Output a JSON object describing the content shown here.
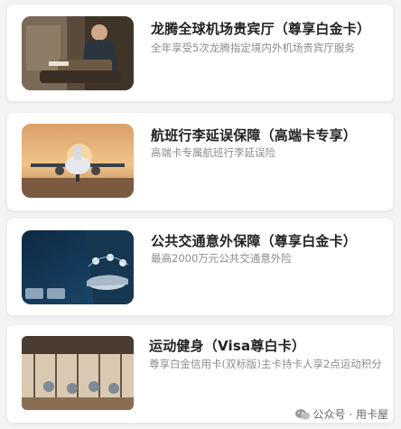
{
  "services": [
    {
      "title": "龙腾全球机场贵宾厅（尊享白金卡）",
      "desc": "全年享受5次龙腾指定境内外机场贵宾厅服务",
      "icon": "airport-lounge-photo"
    },
    {
      "title": "航班行李延误保障（高端卡专享）",
      "desc": "高端卡专属航班行李延误险",
      "icon": "airplane-photo"
    },
    {
      "title": "公共交通意外保障（尊享白金卡）",
      "desc": "最高2000万元公共交通意外险",
      "icon": "transport-insurance-photo"
    },
    {
      "title": "运动健身（Visa尊白卡）",
      "desc": "尊享白金信用卡(双标版)主卡持卡人享2点运动积分",
      "icon": "gym-photo"
    }
  ],
  "watermark": {
    "text": "公众号 · 用卡屋",
    "icon": "wechat-icon"
  }
}
